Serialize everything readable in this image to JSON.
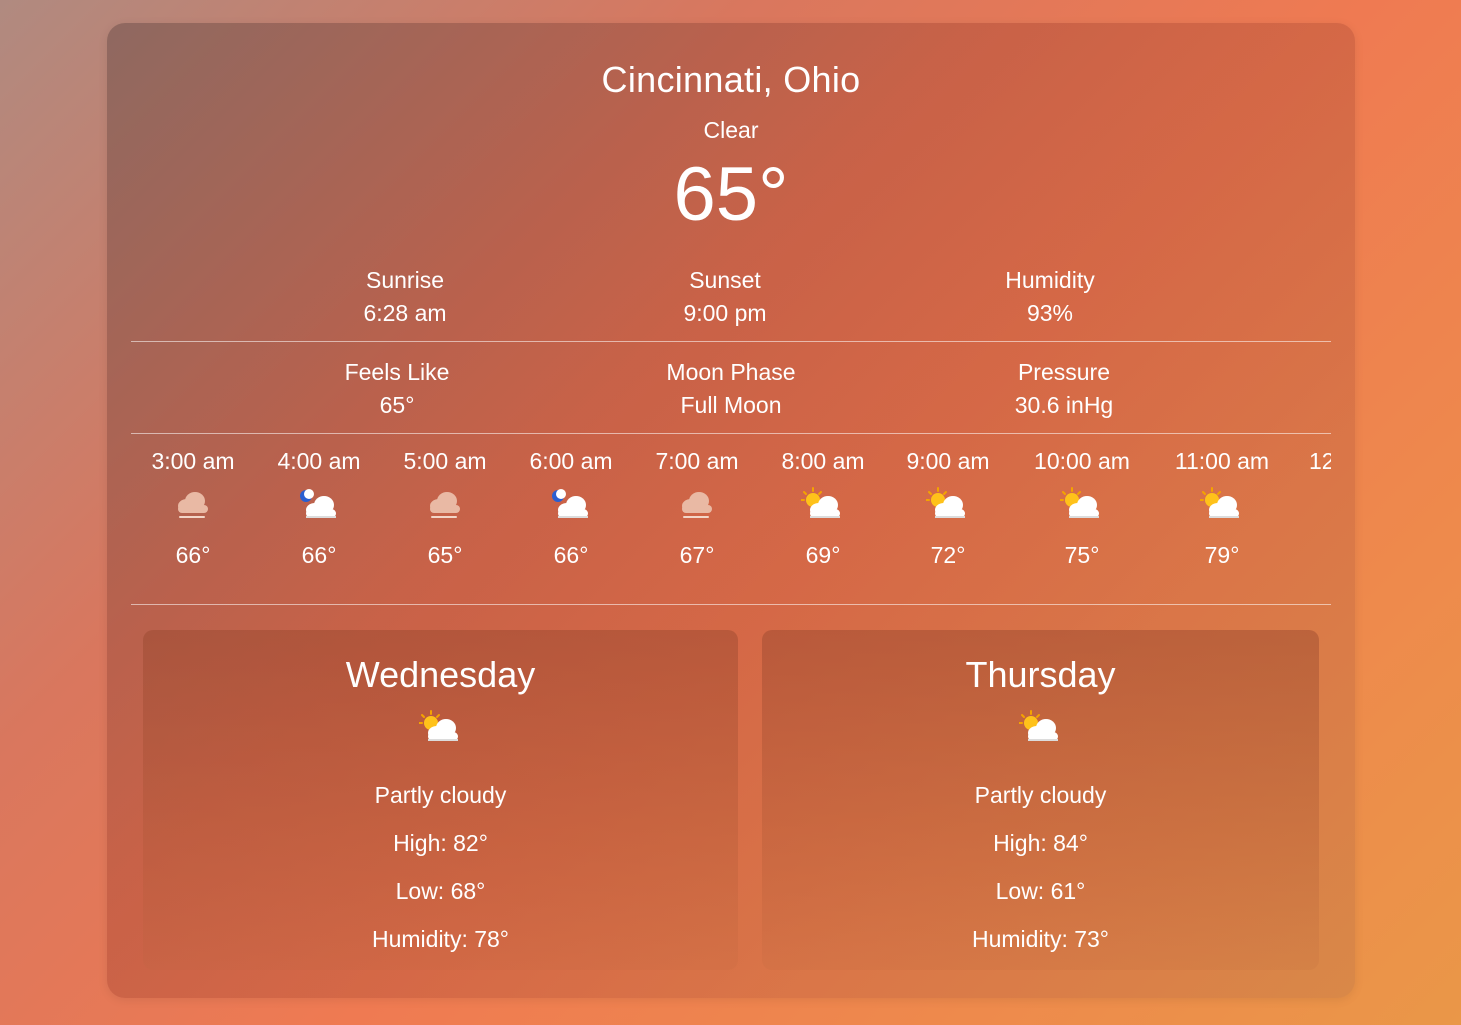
{
  "location": "Cincinnati, Ohio",
  "condition": "Clear",
  "temperature": "65°",
  "stats_row1": [
    {
      "label": "Sunrise",
      "value": "6:28 am"
    },
    {
      "label": "Sunset",
      "value": "9:00 pm"
    },
    {
      "label": "Humidity",
      "value": "93%"
    }
  ],
  "stats_row2": [
    {
      "label": "Feels Like",
      "value": "65°"
    },
    {
      "label": "Moon Phase",
      "value": "Full Moon"
    },
    {
      "label": "Pressure",
      "value": "30.6 inHg"
    }
  ],
  "hourly": [
    {
      "time": "3:00 am",
      "icon": "cloud-fog-icon",
      "temp": "66°"
    },
    {
      "time": "4:00 am",
      "icon": "moon-cloud-icon",
      "temp": "66°"
    },
    {
      "time": "5:00 am",
      "icon": "cloud-fog-icon",
      "temp": "65°"
    },
    {
      "time": "6:00 am",
      "icon": "moon-cloud-icon",
      "temp": "66°"
    },
    {
      "time": "7:00 am",
      "icon": "cloud-fog-icon",
      "temp": "67°"
    },
    {
      "time": "8:00 am",
      "icon": "sun-cloud-icon",
      "temp": "69°"
    },
    {
      "time": "9:00 am",
      "icon": "sun-cloud-icon",
      "temp": "72°"
    },
    {
      "time": "10:00 am",
      "icon": "sun-cloud-icon",
      "temp": "75°"
    },
    {
      "time": "11:00 am",
      "icon": "sun-cloud-icon",
      "temp": "79°"
    },
    {
      "time": "12",
      "icon": "",
      "temp": ""
    }
  ],
  "forecast": [
    {
      "day": "Wednesday",
      "icon": "sun-cloud-icon",
      "condition": "Partly cloudy",
      "high": "High: 82°",
      "low": "Low: 68°",
      "humidity": "Humidity: 78°"
    },
    {
      "day": "Thursday",
      "icon": "sun-cloud-icon",
      "condition": "Partly cloudy",
      "high": "High: 84°",
      "low": "Low: 61°",
      "humidity": "Humidity: 73°"
    }
  ]
}
